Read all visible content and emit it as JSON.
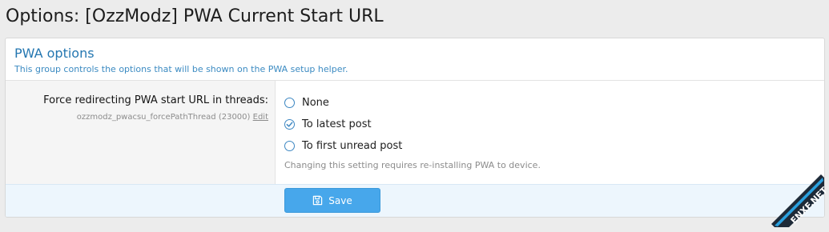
{
  "page": {
    "title": "Options: [OzzModz] PWA Current Start URL"
  },
  "group": {
    "title": "PWA options",
    "description": "This group controls the options that will be shown on the PWA setup helper."
  },
  "option": {
    "label": "Force redirecting PWA start URL in threads:",
    "hint": "ozzmodz_pwacsu_forcePathThread (23000)",
    "edit_label": "Edit",
    "choices": [
      {
        "label": "None",
        "checked": false
      },
      {
        "label": "To latest post",
        "checked": true
      },
      {
        "label": "To first unread post",
        "checked": false
      }
    ],
    "explain": "Changing this setting requires re-installing PWA to device."
  },
  "footer": {
    "save_label": "Save"
  },
  "watermark": {
    "text": "ENXF.NET"
  },
  "colors": {
    "accent": "#47a7eb",
    "link": "#2577b1",
    "radio": "#3d87c2",
    "watermark_dark": "#1e2a38",
    "watermark_accent": "#2aa1e0"
  },
  "icons": {
    "save": "floppy-disk-icon",
    "radio_checked": "checkmark-icon"
  }
}
